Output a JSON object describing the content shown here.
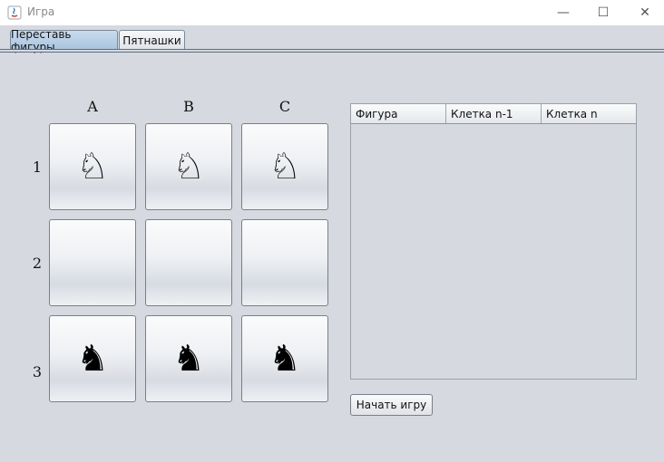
{
  "window": {
    "title": "Игра",
    "minimize_glyph": "—",
    "maximize_glyph": "☐",
    "close_glyph": "✕"
  },
  "tabs": [
    {
      "label": "Переставь фигуры",
      "active": true
    },
    {
      "label": "Пятнашки",
      "active": false
    }
  ],
  "board": {
    "columns": [
      "A",
      "B",
      "C"
    ],
    "rows": [
      "1",
      "2",
      "3"
    ],
    "cells": [
      [
        "♘",
        "♘",
        "♘"
      ],
      [
        "",
        "",
        ""
      ],
      [
        "♞",
        "♞",
        "♞"
      ]
    ]
  },
  "moves_table": {
    "columns": [
      "Фигура",
      "Клетка n-1",
      "Клетка n"
    ],
    "rows": []
  },
  "start_button": "Начать игру"
}
